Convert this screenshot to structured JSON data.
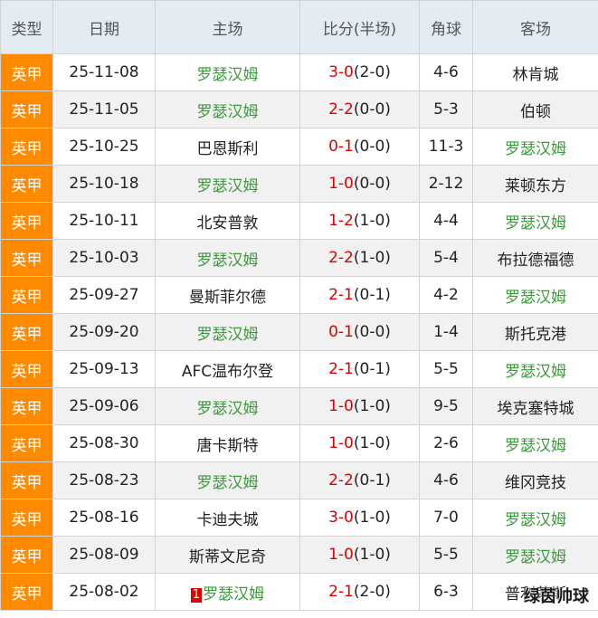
{
  "headers": {
    "type": "类型",
    "date": "日期",
    "home": "主场",
    "score": "比分(半场)",
    "corners": "角球",
    "away": "客场"
  },
  "colors": {
    "type_bg": "#ff8a00",
    "header_bg": "#e4ecf3",
    "highlight_team": "#3a9a3a",
    "score_red": "#e00000"
  },
  "highlight_team": "罗瑟汉姆",
  "rows": [
    {
      "type": "英甲",
      "date": "25-11-08",
      "home": "罗瑟汉姆",
      "score": "3-0",
      "halftime": "(2-0)",
      "corners": "4-6",
      "away": "林肯城"
    },
    {
      "type": "英甲",
      "date": "25-11-05",
      "home": "罗瑟汉姆",
      "score": "2-2",
      "halftime": "(0-0)",
      "corners": "5-3",
      "away": "伯顿"
    },
    {
      "type": "英甲",
      "date": "25-10-25",
      "home": "巴恩斯利",
      "score": "0-1",
      "halftime": "(0-0)",
      "corners": "11-3",
      "away": "罗瑟汉姆"
    },
    {
      "type": "英甲",
      "date": "25-10-18",
      "home": "罗瑟汉姆",
      "score": "1-0",
      "halftime": "(0-0)",
      "corners": "2-12",
      "away": "莱顿东方"
    },
    {
      "type": "英甲",
      "date": "25-10-11",
      "home": "北安普敦",
      "score": "1-2",
      "halftime": "(1-0)",
      "corners": "4-4",
      "away": "罗瑟汉姆"
    },
    {
      "type": "英甲",
      "date": "25-10-03",
      "home": "罗瑟汉姆",
      "score": "2-2",
      "halftime": "(1-0)",
      "corners": "5-4",
      "away": "布拉德福德"
    },
    {
      "type": "英甲",
      "date": "25-09-27",
      "home": "曼斯菲尔德",
      "score": "2-1",
      "halftime": "(0-1)",
      "corners": "4-2",
      "away": "罗瑟汉姆"
    },
    {
      "type": "英甲",
      "date": "25-09-20",
      "home": "罗瑟汉姆",
      "score": "0-1",
      "halftime": "(0-0)",
      "corners": "1-4",
      "away": "斯托克港"
    },
    {
      "type": "英甲",
      "date": "25-09-13",
      "home": "AFC温布尔登",
      "score": "2-1",
      "halftime": "(0-1)",
      "corners": "5-5",
      "away": "罗瑟汉姆"
    },
    {
      "type": "英甲",
      "date": "25-09-06",
      "home": "罗瑟汉姆",
      "score": "1-0",
      "halftime": "(1-0)",
      "corners": "9-5",
      "away": "埃克塞特城"
    },
    {
      "type": "英甲",
      "date": "25-08-30",
      "home": "唐卡斯特",
      "score": "1-0",
      "halftime": "(1-0)",
      "corners": "2-6",
      "away": "罗瑟汉姆"
    },
    {
      "type": "英甲",
      "date": "25-08-23",
      "home": "罗瑟汉姆",
      "score": "2-2",
      "halftime": "(0-1)",
      "corners": "4-6",
      "away": "维冈竞技"
    },
    {
      "type": "英甲",
      "date": "25-08-16",
      "home": "卡迪夫城",
      "score": "3-0",
      "halftime": "(1-0)",
      "corners": "7-0",
      "away": "罗瑟汉姆"
    },
    {
      "type": "英甲",
      "date": "25-08-09",
      "home": "斯蒂文尼奇",
      "score": "1-0",
      "halftime": "(1-0)",
      "corners": "5-5",
      "away": "罗瑟汉姆"
    },
    {
      "type": "英甲",
      "date": "25-08-02",
      "home": "罗瑟汉姆",
      "home_badge": "1",
      "score": "2-1",
      "halftime": "(2-0)",
      "corners": "6-3",
      "away": "普利茅斯"
    }
  ],
  "watermark": "绿茵帅球"
}
